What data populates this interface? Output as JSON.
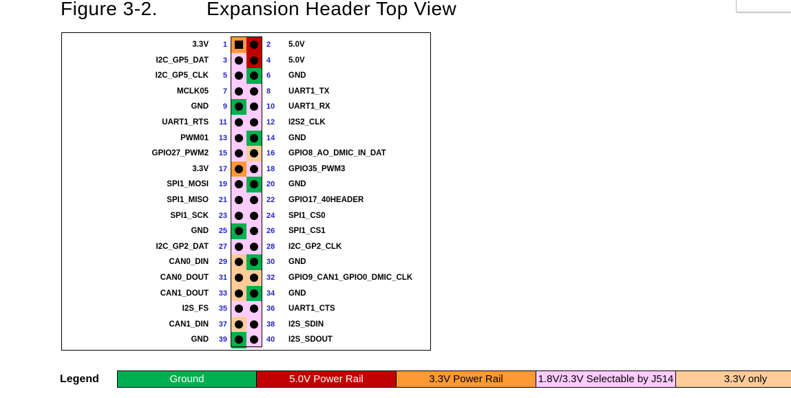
{
  "figure": {
    "label": "Figure 3-2.",
    "title": "Expansion Header Top View"
  },
  "legend": {
    "label": "Legend",
    "items": [
      {
        "key": "ground",
        "text": "Ground",
        "color": "#00b050",
        "text_color": "#ffffff"
      },
      {
        "key": "p5v",
        "text": "5.0V Power Rail",
        "color": "#c00000",
        "text_color": "#ffffff"
      },
      {
        "key": "p33v",
        "text": "3.3V Power Rail",
        "color": "#ff9933",
        "text_color": "#000000"
      },
      {
        "key": "sel",
        "text": "1.8V/3.3V Selectable by J514",
        "color": "#ffccff",
        "text_color": "#000000"
      },
      {
        "key": "only33",
        "text": "3.3V only",
        "color": "#ffcc99",
        "text_color": "#000000"
      }
    ]
  },
  "rows": [
    {
      "left": {
        "num": "1",
        "name": "3.3V",
        "type": "p33v",
        "marker": "square"
      },
      "right": {
        "num": "2",
        "name": "5.0V",
        "type": "p5v"
      }
    },
    {
      "left": {
        "num": "3",
        "name": "I2C_GP5_DAT",
        "type": "sel"
      },
      "right": {
        "num": "4",
        "name": "5.0V",
        "type": "p5v"
      }
    },
    {
      "left": {
        "num": "5",
        "name": "I2C_GP5_CLK",
        "type": "sel"
      },
      "right": {
        "num": "6",
        "name": "GND",
        "type": "ground"
      }
    },
    {
      "left": {
        "num": "7",
        "name": "MCLK05",
        "type": "sel"
      },
      "right": {
        "num": "8",
        "name": "UART1_TX",
        "type": "sel"
      }
    },
    {
      "left": {
        "num": "9",
        "name": "GND",
        "type": "ground"
      },
      "right": {
        "num": "10",
        "name": "UART1_RX",
        "type": "sel"
      }
    },
    {
      "left": {
        "num": "11",
        "name": "UART1_RTS",
        "type": "sel"
      },
      "right": {
        "num": "12",
        "name": "I2S2_CLK",
        "type": "sel"
      }
    },
    {
      "left": {
        "num": "13",
        "name": "PWM01",
        "type": "sel"
      },
      "right": {
        "num": "14",
        "name": "GND",
        "type": "ground"
      }
    },
    {
      "left": {
        "num": "15",
        "name": "GPIO27_PWM2",
        "type": "sel"
      },
      "right": {
        "num": "16",
        "name": "GPIO8_AO_DMIC_IN_DAT",
        "type": "only33"
      }
    },
    {
      "left": {
        "num": "17",
        "name": "3.3V",
        "type": "p33v"
      },
      "right": {
        "num": "18",
        "name": "GPIO35_PWM3",
        "type": "sel"
      }
    },
    {
      "left": {
        "num": "19",
        "name": "SPI1_MOSI",
        "type": "sel"
      },
      "right": {
        "num": "20",
        "name": "GND",
        "type": "ground"
      }
    },
    {
      "left": {
        "num": "21",
        "name": "SPI1_MISO",
        "type": "sel"
      },
      "right": {
        "num": "22",
        "name": "GPIO17_40HEADER",
        "type": "sel"
      }
    },
    {
      "left": {
        "num": "23",
        "name": "SPI1_SCK",
        "type": "sel"
      },
      "right": {
        "num": "24",
        "name": "SPI1_CS0",
        "type": "sel"
      }
    },
    {
      "left": {
        "num": "25",
        "name": "GND",
        "type": "ground"
      },
      "right": {
        "num": "26",
        "name": "SPI1_CS1",
        "type": "sel"
      }
    },
    {
      "left": {
        "num": "27",
        "name": "I2C_GP2_DAT",
        "type": "sel"
      },
      "right": {
        "num": "28",
        "name": "I2C_GP2_CLK",
        "type": "sel"
      }
    },
    {
      "left": {
        "num": "29",
        "name": "CAN0_DIN",
        "type": "only33"
      },
      "right": {
        "num": "30",
        "name": "GND",
        "type": "ground"
      }
    },
    {
      "left": {
        "num": "31",
        "name": "CAN0_DOUT",
        "type": "only33"
      },
      "right": {
        "num": "32",
        "name": "GPIO9_CAN1_GPIO0_DMIC_CLK",
        "type": "only33"
      }
    },
    {
      "left": {
        "num": "33",
        "name": "CAN1_DOUT",
        "type": "only33"
      },
      "right": {
        "num": "34",
        "name": "GND",
        "type": "ground"
      }
    },
    {
      "left": {
        "num": "35",
        "name": "I2S_FS",
        "type": "sel"
      },
      "right": {
        "num": "36",
        "name": "UART1_CTS",
        "type": "sel"
      }
    },
    {
      "left": {
        "num": "37",
        "name": "CAN1_DIN",
        "type": "only33"
      },
      "right": {
        "num": "38",
        "name": "I2S_SDIN",
        "type": "sel"
      }
    },
    {
      "left": {
        "num": "39",
        "name": "GND",
        "type": "ground"
      },
      "right": {
        "num": "40",
        "name": "I2S_SDOUT",
        "type": "sel"
      }
    }
  ]
}
